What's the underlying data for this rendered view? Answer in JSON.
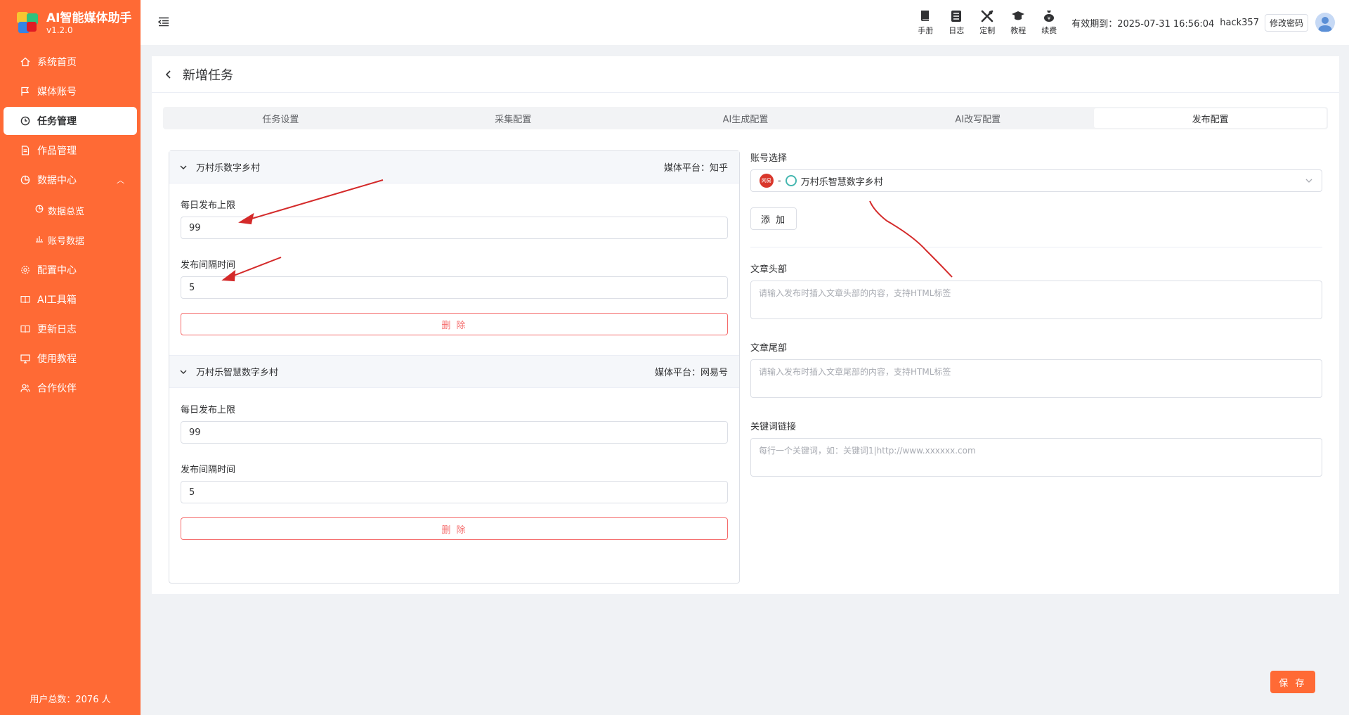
{
  "app": {
    "name": "AI智能媒体助手",
    "version": "v1.2.0"
  },
  "sidebar": {
    "items": [
      {
        "label": "系统首页",
        "icon": "home-icon"
      },
      {
        "label": "媒体账号",
        "icon": "flag-icon"
      },
      {
        "label": "任务管理",
        "icon": "clock-icon",
        "active": true
      },
      {
        "label": "作品管理",
        "icon": "document-icon"
      },
      {
        "label": "数据中心",
        "icon": "chart-icon",
        "expanded": true
      }
    ],
    "subitems": [
      {
        "label": "数据总览",
        "icon": "pie-chart-icon"
      },
      {
        "label": "账号数据",
        "icon": "bar-chart-icon"
      }
    ],
    "items2": [
      {
        "label": "配置中心",
        "icon": "gear-icon"
      },
      {
        "label": "AI工具箱",
        "icon": "book-icon"
      },
      {
        "label": "更新日志",
        "icon": "book-icon"
      },
      {
        "label": "使用教程",
        "icon": "monitor-icon"
      },
      {
        "label": "合作伙伴",
        "icon": "users-icon"
      }
    ],
    "footer": "用户总数：2076 人"
  },
  "header": {
    "tools": [
      {
        "label": "手册",
        "icon": "manual-icon"
      },
      {
        "label": "日志",
        "icon": "log-icon"
      },
      {
        "label": "定制",
        "icon": "tools-icon"
      },
      {
        "label": "教程",
        "icon": "graduation-icon"
      },
      {
        "label": "续费",
        "icon": "money-bag-icon"
      }
    ],
    "expire": "有效期到：2025-07-31 16:56:04",
    "username": "hack357",
    "change_password": "修改密码"
  },
  "page": {
    "title": "新增任务",
    "tabs": [
      "任务设置",
      "采集配置",
      "AI生成配置",
      "AI改写配置",
      "发布配置"
    ],
    "active_tab": 4
  },
  "accounts": [
    {
      "name": "万村乐数字乡村",
      "platform": "媒体平台：知乎",
      "daily_limit_label": "每日发布上限",
      "daily_limit": "99",
      "interval_label": "发布间隔时间",
      "interval": "5",
      "delete": "删 除"
    },
    {
      "name": "万村乐智慧数字乡村",
      "platform": "媒体平台：网易号",
      "daily_limit_label": "每日发布上限",
      "daily_limit": "99",
      "interval_label": "发布间隔时间",
      "interval": "5",
      "delete": "删 除"
    }
  ],
  "right": {
    "account_select_label": "账号选择",
    "selected_badge": "网易",
    "selected_sep": "-",
    "selected_account": "万村乐智慧数字乡村",
    "add_button": "添 加",
    "header_label": "文章头部",
    "header_placeholder": "请输入发布时插入文章头部的内容，支持HTML标签",
    "footer_label": "文章尾部",
    "footer_placeholder": "请输入发布时插入文章尾部的内容，支持HTML标签",
    "keyword_label": "关键词链接",
    "keyword_placeholder": "每行一个关键词，如：关键词1|http://www.xxxxxx.com"
  },
  "save_button": "保 存",
  "colors": {
    "brand": "#ff6a35",
    "danger": "#f56c6c",
    "annotation": "#d42a2a"
  }
}
